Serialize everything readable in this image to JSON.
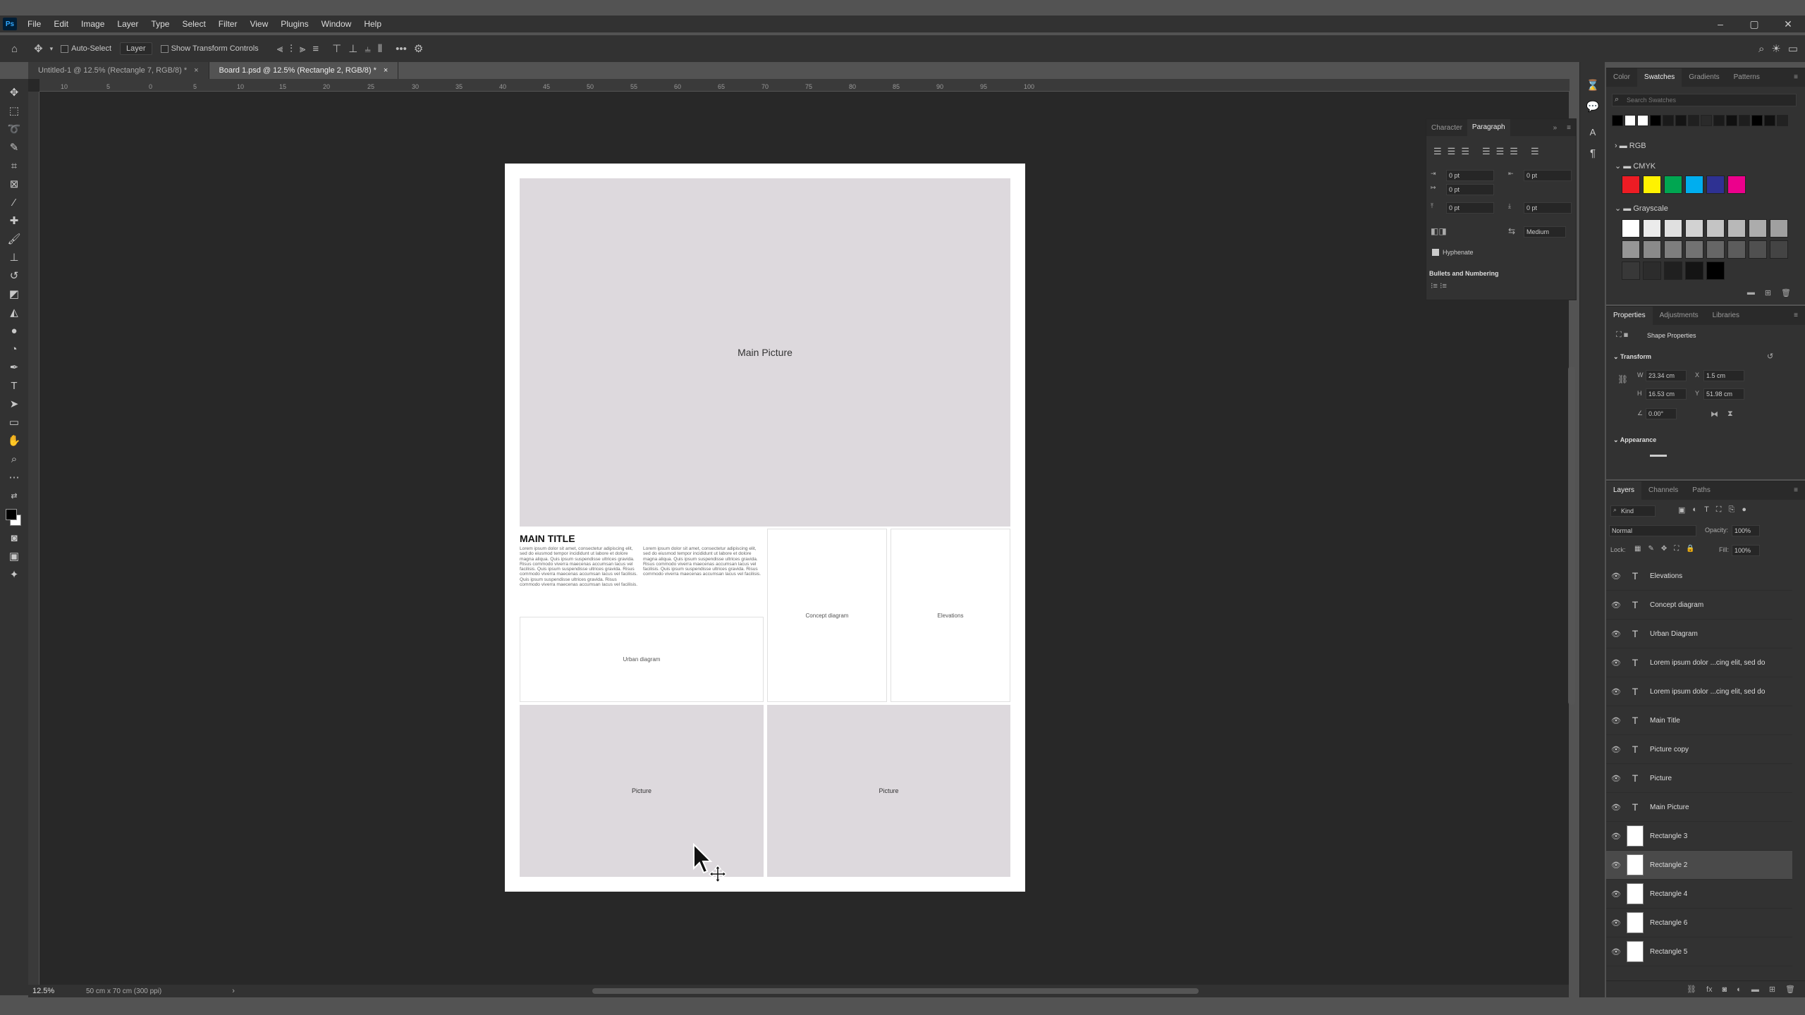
{
  "app": {
    "name": "Photoshop",
    "logo_text": "Ps"
  },
  "menu": [
    "File",
    "Edit",
    "Image",
    "Layer",
    "Type",
    "Select",
    "Filter",
    "View",
    "Plugins",
    "Window",
    "Help"
  ],
  "window_controls": [
    "–",
    "▢",
    "✕"
  ],
  "options_bar": {
    "auto_select_label": "Auto-Select",
    "auto_select_target": "Layer",
    "show_transform_label": "Show Transform Controls",
    "more": "•••"
  },
  "tabs": [
    {
      "label": "Untitled-1 @ 12.5% (Rectangle 7, RGB/8) *",
      "active": false
    },
    {
      "label": "Board 1.psd @ 12.5% (Rectangle 2, RGB/8) *",
      "active": true
    }
  ],
  "ruler_ticks": [
    "10",
    "5",
    "0",
    "5",
    "10",
    "15",
    "20",
    "25",
    "30",
    "35",
    "40",
    "45",
    "50",
    "55",
    "60",
    "65",
    "70",
    "75",
    "80",
    "85",
    "90",
    "95",
    "100"
  ],
  "status": {
    "zoom": "12.5%",
    "doc_info": "50 cm x 70 cm (300 ppi)"
  },
  "document": {
    "main_picture": "Main Picture",
    "main_title": "MAIN TITLE",
    "lorem_col1": "Lorem ipsum dolor sit amet, consectetur adipiscing elit, sed do eiusmod tempor incididunt ut labore et dolore magna aliqua. Quis ipsum suspendisse ultrices gravida. Risus commodo viverra maecenas accumsan lacus vel facilisis. Quis ipsum suspendisse ultrices gravida. Risus commodo viverra maecenas accumsan lacus vel facilisis. Quis ipsum suspendisse ultrices gravida. Risus commodo viverra maecenas accumsan lacus vel facilisis.",
    "lorem_col2": "Lorem ipsum dolor sit amet, consectetur adipiscing elit, sed do eiusmod tempor incididunt ut labore et dolore magna aliqua. Quis ipsum suspendisse ultrices gravida. Risus commodo viverra maecenas accumsan lacus vel facilisis. Quis ipsum suspendisse ultrices gravida. Risus commodo viverra maecenas accumsan lacus vel facilisis.",
    "concept_diagram": "Concept diagram",
    "elevations": "Elevations",
    "urban_diagram": "Urban diagram",
    "picture_left": "Picture",
    "picture_right": "Picture"
  },
  "paragraph_panel": {
    "tabs": [
      "Character",
      "Paragraph"
    ],
    "indent_left": "0 pt",
    "indent_right": "0 pt",
    "indent_first": "0 pt",
    "space_before": "0 pt",
    "space_after": "0 pt",
    "composer": "Medium",
    "hyphenate_label": "Hyphenate",
    "bullets_label": "Bullets and Numbering"
  },
  "swatches_panel": {
    "tabs": [
      "Color",
      "Swatches",
      "Gradients",
      "Patterns"
    ],
    "search_placeholder": "Search Swatches",
    "groups": [
      "RGB",
      "CMYK",
      "Grayscale"
    ],
    "top_row_colors": [
      "#000000",
      "#ffffff",
      "#ffffff",
      "#000000",
      "#1a1a1a",
      "#141414",
      "#202020",
      "#2a2a2a",
      "#1a1a1a",
      "#101010",
      "#1e1e1e",
      "#000000",
      "#101010",
      "#222222"
    ],
    "cmyk_colors": [
      "#ed1c24",
      "#fff200",
      "#00a651",
      "#00aeef",
      "#2e3192",
      "#ec008c"
    ],
    "grayscale_colors": [
      "#ffffff",
      "#ebebeb",
      "#e0e0e0",
      "#d2d2d2",
      "#c4c4c4",
      "#b8b8b8",
      "#acacac",
      "#a0a0a0",
      "#969696",
      "#8a8a8a",
      "#7e7e7e",
      "#727272",
      "#666666",
      "#5c5c5c",
      "#505050",
      "#444444",
      "#383838",
      "#2c2c2c",
      "#202020",
      "#141414",
      "#000000"
    ]
  },
  "properties_panel": {
    "tabs": [
      "Properties",
      "Adjustments",
      "Libraries"
    ],
    "shape_title": "Shape Properties",
    "transform_label": "Transform",
    "w_label": "W",
    "w": "23.34 cm",
    "h_label": "H",
    "h": "16.53 cm",
    "x_label": "X",
    "x": "1.5 cm",
    "y_label": "Y",
    "y": "51.98 cm",
    "angle": "0.00°",
    "appearance_label": "Appearance"
  },
  "layers_panel": {
    "tabs": [
      "Layers",
      "Channels",
      "Paths"
    ],
    "filter_kind": "Kind",
    "blend_mode": "Normal",
    "opacity_label": "Opacity:",
    "opacity": "100%",
    "lock_label": "Lock:",
    "fill_label": "Fill:",
    "fill": "100%",
    "layers": [
      {
        "name": "Elevations",
        "kind": "text"
      },
      {
        "name": "Concept diagram",
        "kind": "text"
      },
      {
        "name": "Urban Diagram",
        "kind": "text"
      },
      {
        "name": "Lorem ipsum dolor ...cing elit, sed do",
        "kind": "text"
      },
      {
        "name": "Lorem ipsum dolor ...cing elit, sed do",
        "kind": "text"
      },
      {
        "name": "Main Title",
        "kind": "text"
      },
      {
        "name": "Picture copy",
        "kind": "text"
      },
      {
        "name": "Picture",
        "kind": "text"
      },
      {
        "name": "Main Picture",
        "kind": "text"
      },
      {
        "name": "Rectangle 3",
        "kind": "shape"
      },
      {
        "name": "Rectangle 2",
        "kind": "shape",
        "selected": true
      },
      {
        "name": "Rectangle 4",
        "kind": "shape"
      },
      {
        "name": "Rectangle 6",
        "kind": "shape"
      },
      {
        "name": "Rectangle 5",
        "kind": "shape"
      }
    ]
  },
  "accent_color": "#4a4a4a"
}
